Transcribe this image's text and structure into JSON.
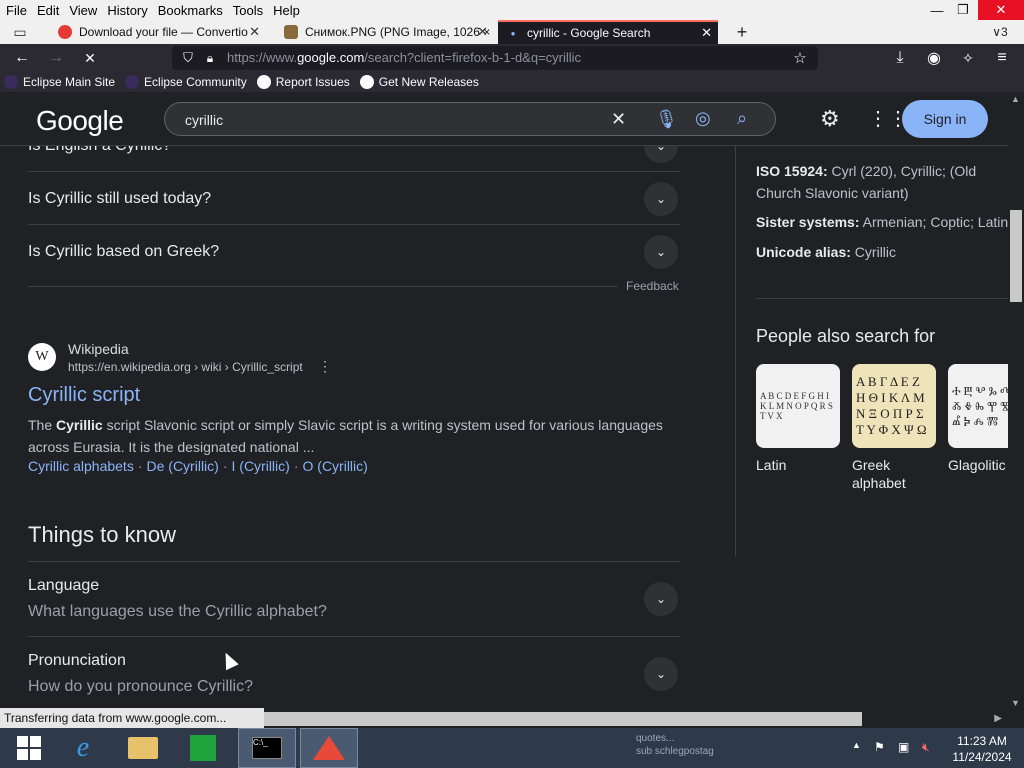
{
  "menubar": {
    "items": [
      "File",
      "Edit",
      "View",
      "History",
      "Bookmarks",
      "Tools",
      "Help"
    ]
  },
  "tabs": [
    {
      "title": "Download your file — Convertio",
      "close": "✕"
    },
    {
      "title": "Снимок.PNG (PNG Image, 1026 ×",
      "close": "✕"
    },
    {
      "title": "cyrillic - Google Search",
      "close": "✕"
    }
  ],
  "tabbar": {
    "new_tab": "+",
    "tab_count": "3"
  },
  "navbar": {
    "url_prefix": "https://www.",
    "url_domain": "google.com",
    "url_rest": "/search?client=firefox-b-1-d&q=cyrillic"
  },
  "bookmarks": [
    "Eclipse Main Site",
    "Eclipse Community",
    "Report Issues",
    "Get New Releases"
  ],
  "google": {
    "logo": "Google",
    "query": "cyrillic",
    "signin": "Sign in"
  },
  "faq": [
    {
      "question": "Is English a Cyrillic?"
    },
    {
      "question": "Is Cyrillic still used today?"
    },
    {
      "question": "Is Cyrillic based on Greek?"
    }
  ],
  "feedback": "Feedback",
  "result": {
    "site_name": "Wikipedia",
    "favicon_letter": "W",
    "url": "https://en.wikipedia.org › wiki › Cyrillic_script",
    "title": "Cyrillic script",
    "snippet_pre": "The ",
    "snippet_bold": "Cyrillic",
    "snippet_post": " script Slavonic script or simply Slavic script is a writing system used for various languages across Eurasia. It is the designated national ...",
    "links": [
      "Cyrillic alphabets",
      "De (Cyrillic)",
      "I (Cyrillic)",
      "O (Cyrillic)"
    ],
    "link_separator": "·"
  },
  "things_to_know": {
    "title": "Things to know",
    "items": [
      {
        "heading": "Language",
        "question": "What languages use the Cyrillic alphabet?"
      },
      {
        "heading": "Pronunciation",
        "question": "How do you pronounce Cyrillic?"
      }
    ]
  },
  "knowledge_panel": {
    "iso_label": "ISO 15924:",
    "iso_value": " Cyrl (220), Cyrillic; (Old Church Slavonic variant)",
    "sister_label": "Sister systems:",
    "sister_value": " Armenian; Coptic; Latin",
    "unicode_label": "Unicode alias:",
    "unicode_value": " Cyrillic"
  },
  "people_also_search": {
    "title": "People also search for",
    "items": [
      {
        "label": "Latin",
        "thumb": "A B C D E F G H I K L M N O P Q R S T V X"
      },
      {
        "label": "Greek alphabet",
        "thumb": "Α Β Γ Δ Ε Ζ Η Θ Ι Κ Λ Μ Ν Ξ Ο Π Ρ Σ Τ Υ Φ Χ Ψ Ω"
      },
      {
        "label": "Glagolitic",
        "thumb": "Ⰰ Ⰱ Ⰲ Ⰳ Ⰴ Ⰵ Ⰶ Ⰷ Ⰸ Ⰹ Ⰺ Ⰻ Ⰼ Ⰽ Ⰾ Ⰿ"
      }
    ]
  },
  "status": "Transferring data from www.google.com...",
  "taskbar": {
    "tray_line1": "quotes...",
    "tray_line2": "sub schlegpostag",
    "time": "11:23 AM",
    "date": "11/24/2024"
  },
  "colors": {
    "page_bg": "#202124",
    "link": "#8ab4f8",
    "active_tab_accent": "#ff6d5f",
    "signin_bg": "#8ab4f8"
  }
}
